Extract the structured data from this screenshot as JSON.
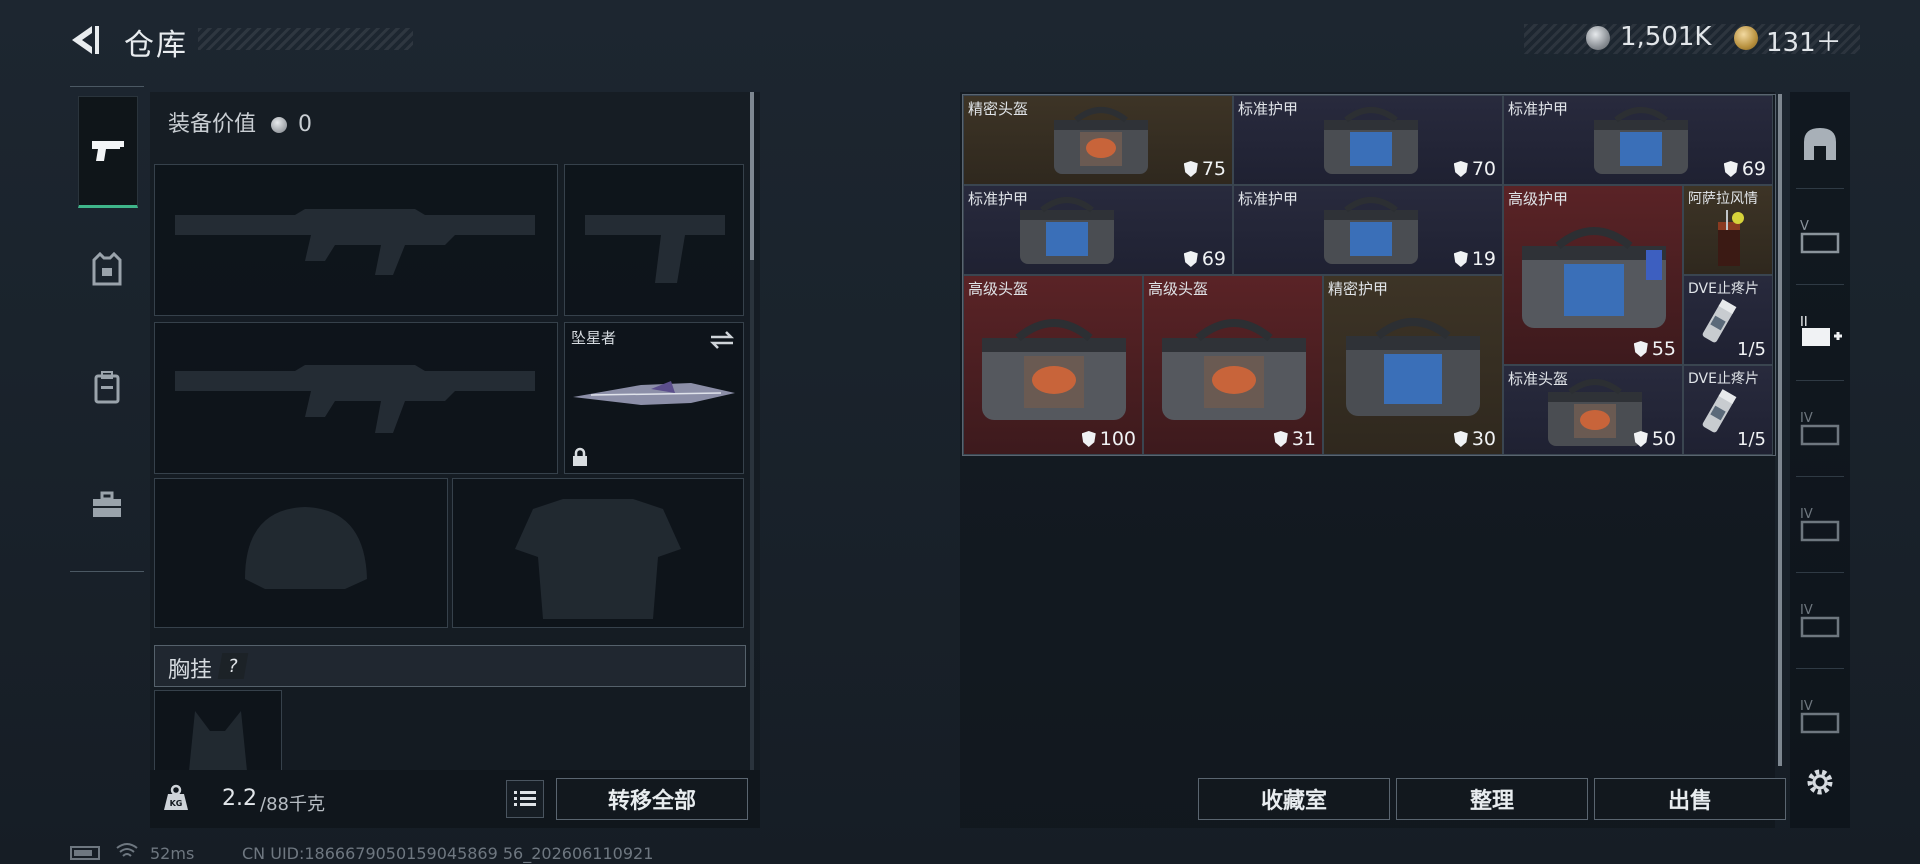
{
  "header": {
    "title": "仓库"
  },
  "currency": {
    "silver": "1,501K",
    "gold": "131＋",
    "silver_color": "#a6abb0",
    "gold_color": "#c9a45a"
  },
  "equipment": {
    "value_label": "装备价值",
    "value": "0",
    "knife_slot_name": "坠星者",
    "chest_rig_label": "胸挂",
    "help": "?"
  },
  "weight": {
    "current": "2.2",
    "max": "/88千克",
    "icon_text": "KG"
  },
  "buttons": {
    "transfer_all": "转移全部",
    "collection": "收藏室",
    "organize": "整理",
    "sell": "出售"
  },
  "status": {
    "latency": "52ms",
    "uid": "CN UID:1866679050159045869 56_202606110921"
  },
  "stash_items": [
    {
      "name": "精密头盔",
      "value": "75",
      "rarity": "gold"
    },
    {
      "name": "标准护甲",
      "value": "70",
      "rarity": "purple"
    },
    {
      "name": "标准护甲",
      "value": "69",
      "rarity": "purple"
    },
    {
      "name": "标准护甲",
      "value": "69",
      "rarity": "purple"
    },
    {
      "name": "标准护甲",
      "value": "19",
      "rarity": "purple"
    },
    {
      "name": "高级护甲",
      "value": "55",
      "rarity": "red"
    },
    {
      "name": "阿萨拉风情",
      "value": "",
      "rarity": "gold"
    },
    {
      "name": "高级头盔",
      "value": "100",
      "rarity": "red"
    },
    {
      "name": "高级头盔",
      "value": "31",
      "rarity": "red"
    },
    {
      "name": "精密护甲",
      "value": "30",
      "rarity": "gold"
    },
    {
      "name": "DVE止疼片",
      "value": "1/5",
      "rarity": "purple"
    },
    {
      "name": "标准头盔",
      "value": "50",
      "rarity": "purple"
    },
    {
      "name": "DVE止疼片",
      "value": "1/5",
      "rarity": "purple"
    }
  ],
  "sidebar_tab_labels": [
    "V",
    "II",
    "IV",
    "IV",
    "IV",
    "IV"
  ]
}
